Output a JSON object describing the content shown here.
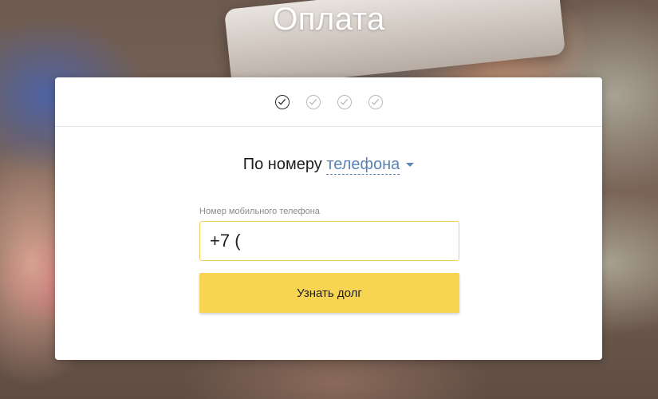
{
  "page": {
    "title": "Оплата"
  },
  "steps": [
    {
      "icon": "check-icon",
      "state": "active"
    },
    {
      "icon": "check-icon",
      "state": "inactive"
    },
    {
      "icon": "check-icon",
      "state": "inactive"
    },
    {
      "icon": "check-icon",
      "state": "inactive"
    }
  ],
  "method": {
    "prefix": "По номеру",
    "selected": "телефона",
    "caret_icon": "caret-down-icon"
  },
  "form": {
    "phone_label": "Номер мобильного телефона",
    "phone_value": "+7 (",
    "submit_label": "Узнать долг"
  },
  "colors": {
    "accent_yellow": "#f7d451",
    "input_border": "#f2d25a",
    "link_blue": "#5a84b5"
  }
}
